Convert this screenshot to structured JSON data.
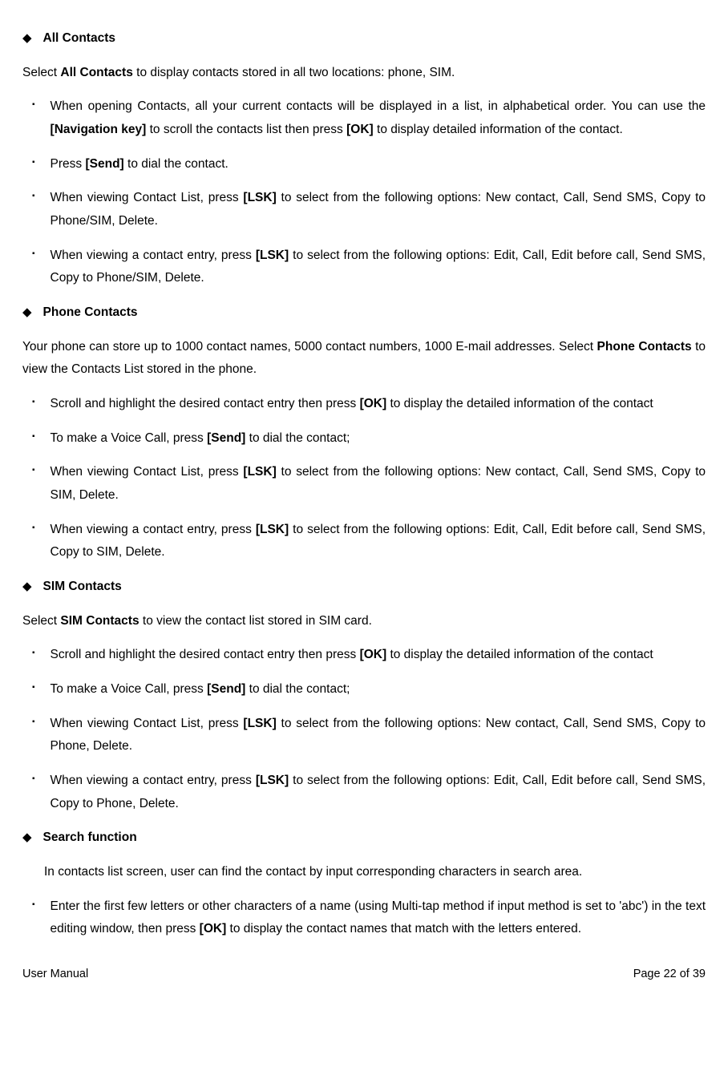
{
  "sections": [
    {
      "title": "All Contacts",
      "intro_pre": "Select ",
      "intro_bold": "All Contacts",
      "intro_post": " to display contacts stored in all two locations: phone, SIM.",
      "intro_indented": false,
      "items": [
        {
          "segments": [
            {
              "t": "When opening Contacts, all your current contacts will be displayed in a list, in alphabetical order. You can use the "
            },
            {
              "t": "[Navigation key]",
              "b": true
            },
            {
              "t": " to scroll the contacts list then press "
            },
            {
              "t": "[OK]",
              "b": true
            },
            {
              "t": " to display detailed information of the contact."
            }
          ]
        },
        {
          "segments": [
            {
              "t": "Press "
            },
            {
              "t": "[Send]",
              "b": true
            },
            {
              "t": " to dial the contact."
            }
          ]
        },
        {
          "segments": [
            {
              "t": "When viewing Contact List, press "
            },
            {
              "t": "[LSK]",
              "b": true
            },
            {
              "t": " to select from the following options: New contact, Call, Send SMS, Copy to Phone/SIM, Delete."
            }
          ]
        },
        {
          "segments": [
            {
              "t": "When viewing a contact entry, press "
            },
            {
              "t": "[LSK]",
              "b": true
            },
            {
              "t": " to select from the following options: Edit, Call, Edit before call, Send SMS, Copy to Phone/SIM, Delete."
            }
          ]
        }
      ]
    },
    {
      "title": "Phone Contacts",
      "intro_pre": "Your phone can store up to 1000 contact names, 5000 contact numbers, 1000 E-mail addresses. Select ",
      "intro_bold": "Phone Contacts",
      "intro_post": " to view the Contacts List stored in the phone.",
      "intro_indented": false,
      "items": [
        {
          "segments": [
            {
              "t": "Scroll and highlight the desired contact entry then press "
            },
            {
              "t": "[OK]",
              "b": true
            },
            {
              "t": " to display the detailed information of the contact"
            }
          ]
        },
        {
          "segments": [
            {
              "t": "To make a Voice Call, press "
            },
            {
              "t": "[Send]",
              "b": true
            },
            {
              "t": " to dial the contact;"
            }
          ]
        },
        {
          "segments": [
            {
              "t": "When viewing Contact List, press "
            },
            {
              "t": "[LSK]",
              "b": true
            },
            {
              "t": " to select from the following options: New contact, Call, Send SMS, Copy to SIM, Delete."
            }
          ]
        },
        {
          "segments": [
            {
              "t": "When viewing a contact entry, press "
            },
            {
              "t": "[LSK]",
              "b": true
            },
            {
              "t": " to select from the following options: Edit, Call, Edit before call, Send SMS, Copy to SIM, Delete."
            }
          ]
        }
      ]
    },
    {
      "title": "SIM Contacts",
      "intro_pre": "Select ",
      "intro_bold": "SIM Contacts",
      "intro_post": " to view the contact list stored in SIM card.",
      "intro_indented": false,
      "items": [
        {
          "segments": [
            {
              "t": "Scroll and highlight the desired contact entry then press "
            },
            {
              "t": "[OK]",
              "b": true
            },
            {
              "t": " to display the detailed information of the contact"
            }
          ]
        },
        {
          "segments": [
            {
              "t": "To make a Voice Call, press "
            },
            {
              "t": "[Send]",
              "b": true
            },
            {
              "t": " to dial the contact;"
            }
          ]
        },
        {
          "segments": [
            {
              "t": "When viewing Contact List, press "
            },
            {
              "t": "[LSK]",
              "b": true
            },
            {
              "t": " to select from the following options: New contact, Call, Send SMS, Copy to Phone, Delete."
            }
          ]
        },
        {
          "segments": [
            {
              "t": "When viewing a contact entry, press "
            },
            {
              "t": "[LSK]",
              "b": true
            },
            {
              "t": " to select from the following options: Edit, Call, Edit before call, Send SMS, Copy to Phone, Delete."
            }
          ]
        }
      ]
    },
    {
      "title": "Search function",
      "intro_pre": "In contacts list screen, user can find the contact by input corresponding characters in search area.",
      "intro_bold": "",
      "intro_post": "",
      "intro_indented": true,
      "items": [
        {
          "segments": [
            {
              "t": "Enter the first few letters or other characters of a name (using Multi-tap method if input method is set to 'abc') in the text editing window, then press "
            },
            {
              "t": "[OK]",
              "b": true
            },
            {
              "t": " to display the contact names that match with the letters entered."
            }
          ]
        }
      ]
    }
  ],
  "footer": {
    "left": "User Manual",
    "right": "Page 22 of 39"
  }
}
